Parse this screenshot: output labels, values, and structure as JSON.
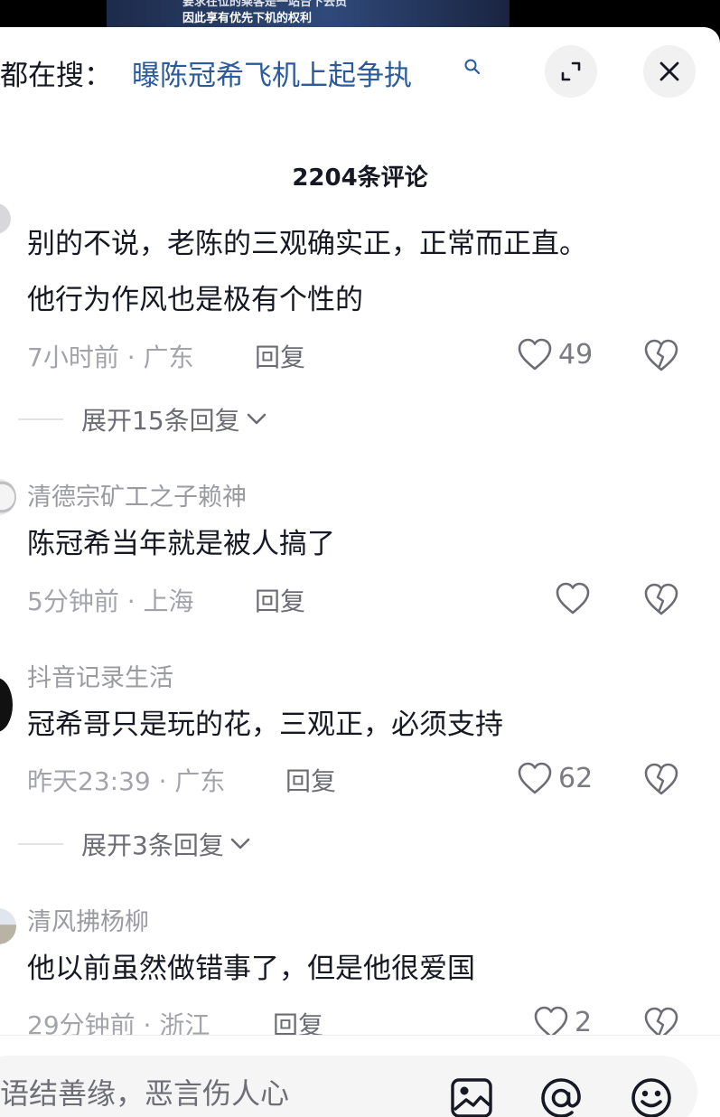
{
  "video": {
    "subtitle_line1": "要求在位的乘客是一站台下去员",
    "subtitle_line2": "因此享有优先下机的权利"
  },
  "search": {
    "prefix": "都在搜：",
    "query": "曝陈冠希飞机上起争执",
    "icon": "search-icon"
  },
  "header": {
    "comment_count": "2204条评论",
    "expand_icon": "expand-icon",
    "close_icon": "close-icon"
  },
  "comments": [
    {
      "username": "",
      "text_lines": [
        "别的不说，老陈的三观确实正，正常而正直。",
        "他行为作风也是极有个性的"
      ],
      "time": "7小时前",
      "location": "广东",
      "reply_label": "回复",
      "likes": "49",
      "expand_replies": "展开15条回复"
    },
    {
      "username": "清德宗矿工之子赖神",
      "text_lines": [
        "陈冠希当年就是被人搞了"
      ],
      "time": "5分钟前",
      "location": "上海",
      "reply_label": "回复",
      "likes": ""
    },
    {
      "username": "抖音记录生活",
      "text_lines": [
        "冠希哥只是玩的花，三观正，必须支持"
      ],
      "time": "昨天23:39",
      "location": "广东",
      "reply_label": "回复",
      "likes": "62",
      "expand_replies": "展开3条回复"
    },
    {
      "username": "清风拂杨柳",
      "text_lines": [
        "他以前虽然做错事了，但是他很爱国"
      ],
      "time": "29分钟前",
      "location": "浙江",
      "reply_label": "回复",
      "likes": "2"
    }
  ],
  "meta_separator": " · ",
  "composer": {
    "placeholder": "善语结善缘，恶言伤人心",
    "icons": [
      "image-icon",
      "at-icon",
      "emoji-icon"
    ]
  },
  "colors": {
    "link": "#2b5b9a",
    "primary_text": "#161823",
    "secondary_text": "#a3a4aa"
  }
}
